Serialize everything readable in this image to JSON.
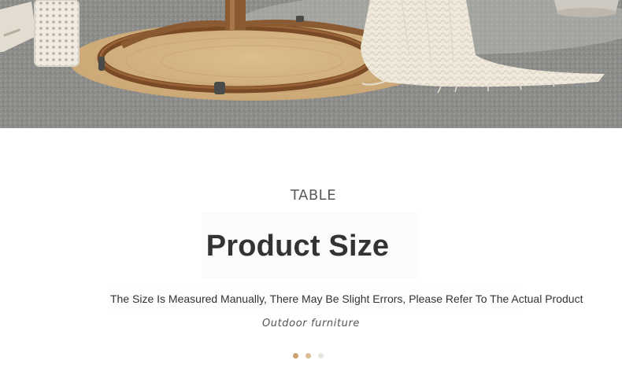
{
  "hero": {
    "image_subject": "rattan hanging chair base on round jute rug with knit throw, lattice lantern and planter"
  },
  "section": {
    "eyebrow": "TABLE",
    "title": "Product Size",
    "subtitle": "The Size Is Measured Manually, There May Be Slight Errors, Please Refer To The Actual Product",
    "tagline": "Outdoor furniture"
  },
  "carousel": {
    "slides": 3,
    "active_index": 0,
    "colors": {
      "active": "#c8a36e",
      "second": "#d9bf98",
      "inactive": "#e6e6df"
    }
  },
  "colors": {
    "text_dark": "#333333",
    "text_muted": "#5a5a5a",
    "frame_brown": "#8a5a33",
    "rug_tan": "#d9b886"
  }
}
